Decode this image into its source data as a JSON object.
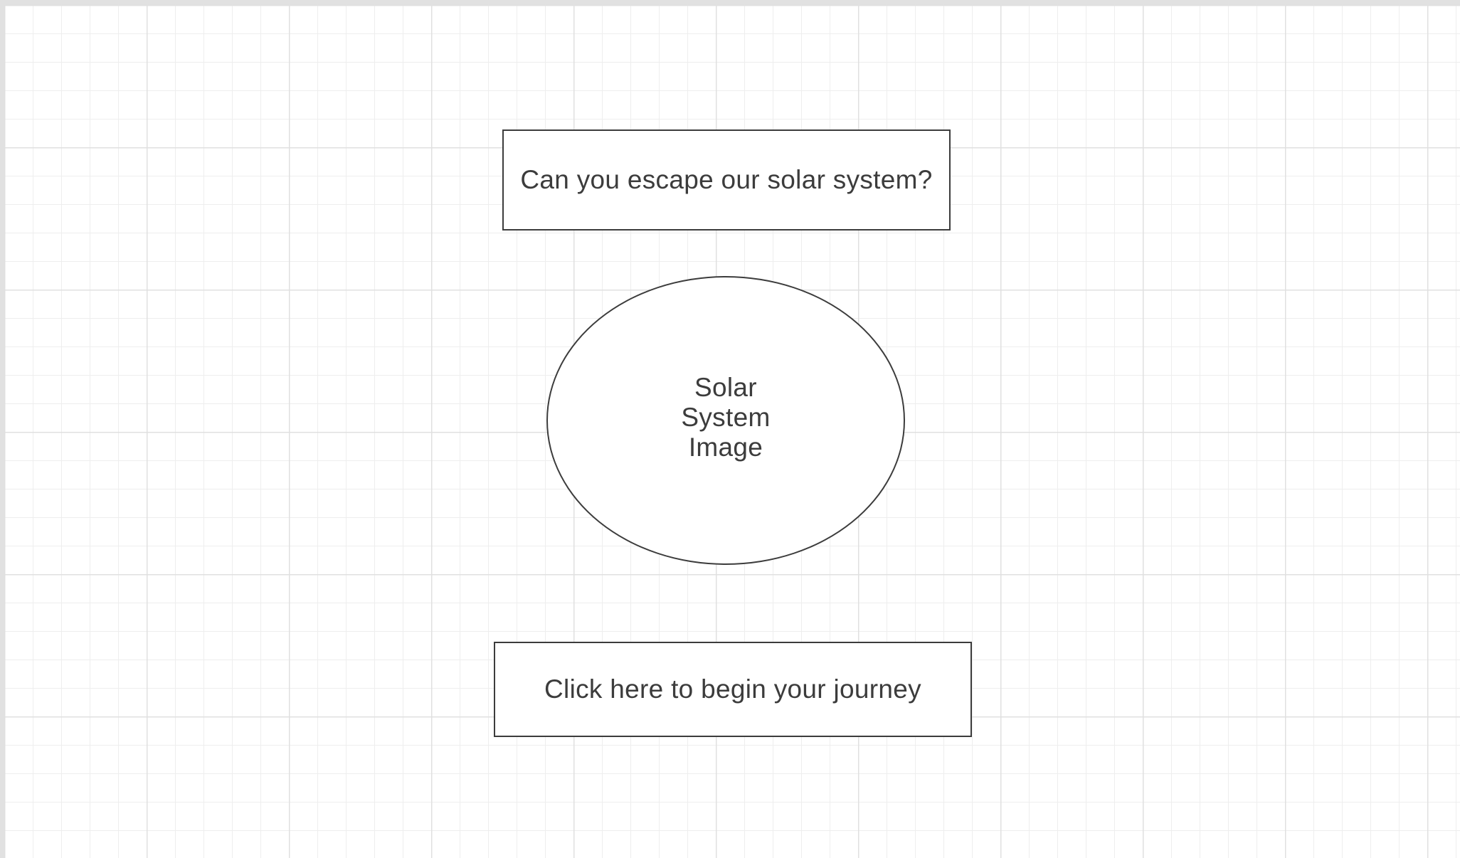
{
  "canvas": {
    "background_color": "#ffffff",
    "grid_minor_color": "#eeeeee",
    "grid_major_color": "#e0e0e0",
    "shape_stroke_color": "#3c3c3c",
    "text_color": "#3c3c3c"
  },
  "wireframe": {
    "title_text": "Can you escape our solar system?",
    "image_placeholder_text": "Solar System Image",
    "start_button_label": "Click here to begin your journey"
  }
}
